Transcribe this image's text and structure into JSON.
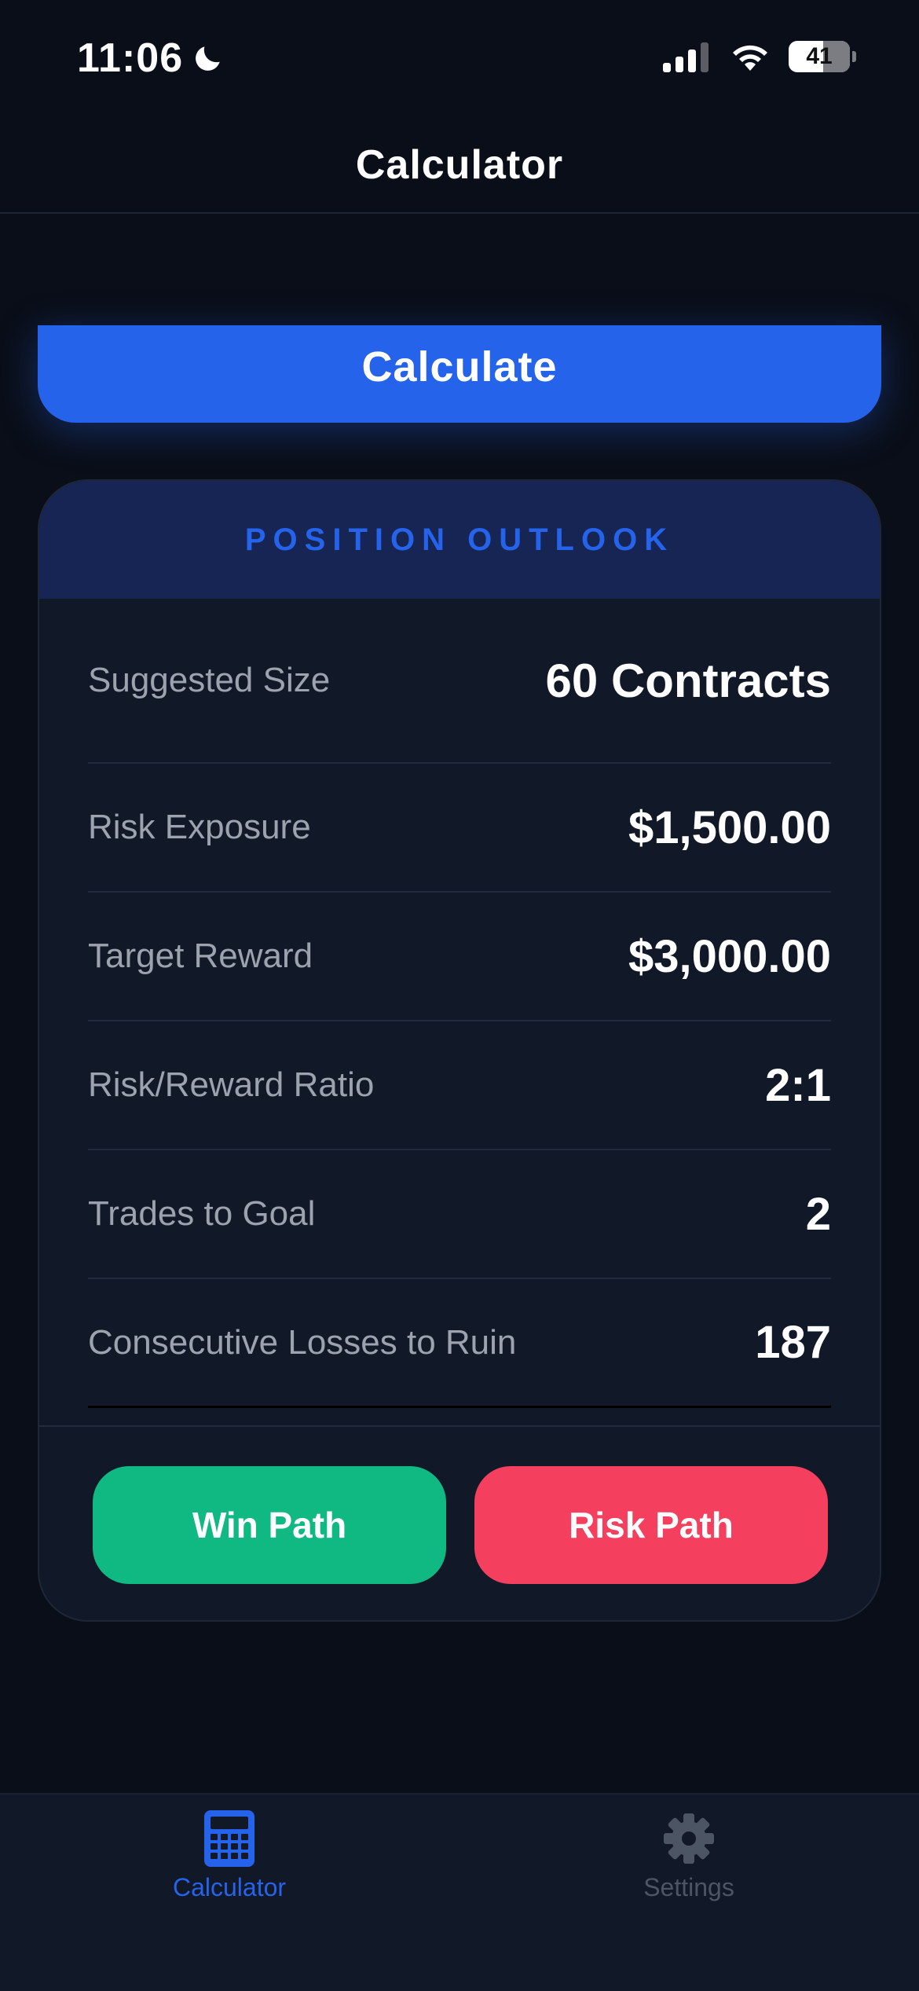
{
  "status_bar": {
    "time": "11:06",
    "battery": "41",
    "battery_level_percent": 56
  },
  "nav": {
    "title": "Calculator"
  },
  "actions": {
    "calculate_label": "Calculate"
  },
  "outlook": {
    "header": "POSITION OUTLOOK",
    "rows": [
      {
        "label": "Suggested Size",
        "value": "60 Contracts"
      },
      {
        "label": "Risk Exposure",
        "value": "$1,500.00"
      },
      {
        "label": "Target Reward",
        "value": "$3,000.00"
      },
      {
        "label": "Risk/Reward Ratio",
        "value": "2:1"
      },
      {
        "label": "Trades to Goal",
        "value": "2"
      },
      {
        "label": "Consecutive Losses to Ruin",
        "value": "187"
      }
    ],
    "win_path_label": "Win Path",
    "risk_path_label": "Risk Path"
  },
  "tabs": [
    {
      "label": "Calculator",
      "icon": "calculator-icon",
      "active": true
    },
    {
      "label": "Settings",
      "icon": "gear-icon",
      "active": false
    }
  ],
  "colors": {
    "accent": "#2563eb",
    "win": "#10b981",
    "risk": "#f43f5e",
    "background": "#0a0e18",
    "card": "#111827"
  }
}
